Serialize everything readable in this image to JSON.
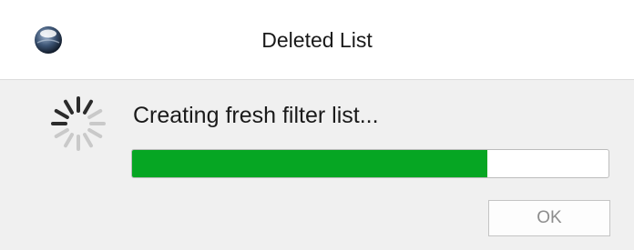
{
  "window": {
    "title": "Deleted List",
    "app_icon": "globe-icon"
  },
  "content": {
    "spinner_icon": "loading-spinner-icon",
    "status_text": "Creating fresh filter list...",
    "progress_fraction": 0.745,
    "progress_color": "#06a623"
  },
  "buttons": {
    "ok_label": "OK",
    "ok_enabled": false
  }
}
